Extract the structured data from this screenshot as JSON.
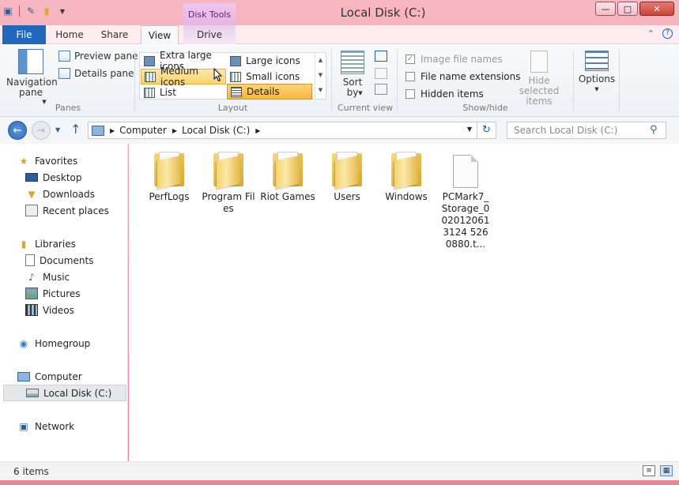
{
  "window": {
    "title": "Local Disk (C:)",
    "minimize_glyph": "—",
    "maximize_glyph": "□",
    "close_glyph": "✕"
  },
  "ribbon_tabs": {
    "file": "File",
    "home": "Home",
    "share": "Share",
    "view": "View",
    "drive": "Drive",
    "context_header": "Disk Tools",
    "active": "View"
  },
  "panes_group": {
    "label": "Panes",
    "navigation_pane": "Navigation pane",
    "preview_pane": "Preview pane",
    "details_pane": "Details pane"
  },
  "layout_group": {
    "label": "Layout",
    "options": [
      "Extra large icons",
      "Large icons",
      "Medium icons",
      "Small icons",
      "List",
      "Details"
    ],
    "selected": "Details",
    "hovered": "Medium icons"
  },
  "current_view_group": {
    "label": "Current view",
    "sort_by": "Sort by"
  },
  "show_hide_group": {
    "label": "Show/hide",
    "item_check_boxes": "Image file names",
    "file_name_extensions": "File name extensions",
    "hidden_items": "Hidden items",
    "hide_selected_items": "Hide selected items"
  },
  "options": {
    "label": "Options"
  },
  "address": {
    "crumbs": [
      "Computer",
      "Local Disk (C:)"
    ],
    "search_placeholder": "Search Local Disk (C:)"
  },
  "nav_pane": {
    "favorites": "Favorites",
    "favorite_items": [
      "Desktop",
      "Downloads",
      "Recent places"
    ],
    "libraries": "Libraries",
    "library_items": [
      "Documents",
      "Music",
      "Pictures",
      "Videos"
    ],
    "homegroup": "Homegroup",
    "computer": "Computer",
    "computer_items": [
      "Local Disk (C:)"
    ],
    "network": "Network",
    "selected": "Local Disk (C:)"
  },
  "files": [
    {
      "name": "PerfLogs",
      "type": "folder"
    },
    {
      "name": "Program Files",
      "type": "folder"
    },
    {
      "name": "Riot Games",
      "type": "folder"
    },
    {
      "name": "Users",
      "type": "folder"
    },
    {
      "name": "Windows",
      "type": "folder"
    },
    {
      "name": "PCMark7_Storage_0020120613124 5260880.t...",
      "type": "file"
    }
  ],
  "status": {
    "item_count": "6 items"
  },
  "colors": {
    "accent": "#2367bd",
    "window_frame": "#ee93a4",
    "selection_hot": "#fbd36b",
    "context_tab": "#e6b4e4"
  }
}
